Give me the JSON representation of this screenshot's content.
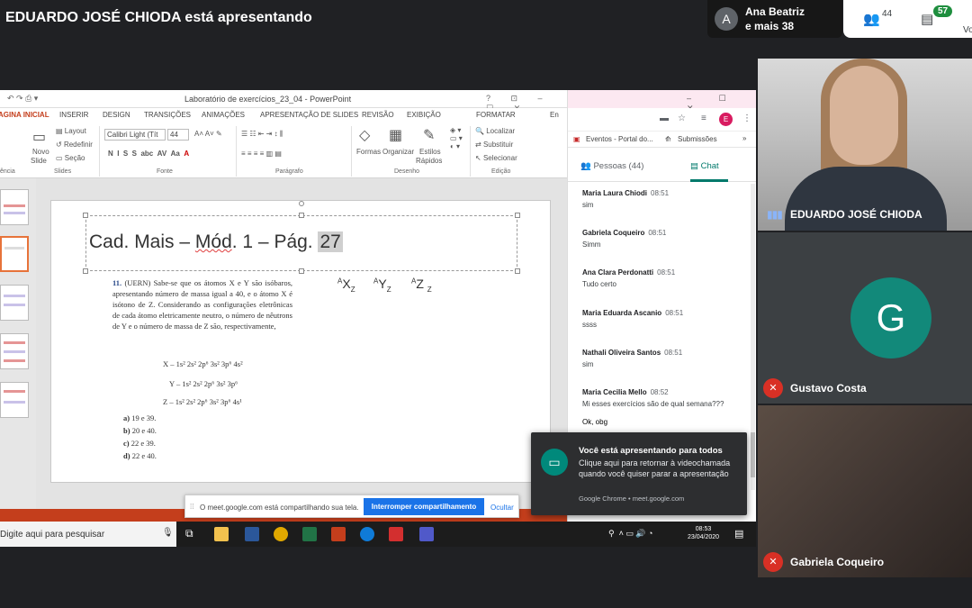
{
  "meet": {
    "presenter_banner": "EDUARDO JOSÉ CHIODA está apresentando",
    "top_user": {
      "avatar_letter": "A",
      "name": "Ana Beatriz",
      "others": "e mais 38"
    },
    "people_count": "44",
    "chat_badge": "57",
    "you_label": "Vo"
  },
  "powerpoint": {
    "window_title": "Laboratório de exercícios_23_04 - PowerPoint",
    "window_controls": "? ⊡ – ☐ ✕",
    "tabs": [
      "AGINA INICIAL",
      "INSERIR",
      "DESIGN",
      "TRANSIÇÕES",
      "ANIMAÇÕES",
      "APRESENTAÇÃO DE SLIDES",
      "REVISÃO",
      "EXIBIÇÃO",
      "FORMATAR",
      "En"
    ],
    "ribbon": {
      "layout": "Layout",
      "redefinir": "Redefinir",
      "secao": "Seção",
      "novo_slide": "Novo",
      "novo_slide2": "Slide",
      "font_name": "Calibri Light (Tít",
      "font_size": "44",
      "formas": "Formas",
      "organizar": "Organizar",
      "estilos": "Estilos",
      "estilos2": "Rápidos",
      "localizar": "Localizar",
      "substituir": "Substituir",
      "selecionar": "Selecionar",
      "groups": {
        "area": "ência",
        "slides": "Slides",
        "fonte": "Fonte",
        "paragrafo": "Parágrafo",
        "desenho": "Desenho",
        "edicao": "Edição"
      }
    },
    "slide": {
      "title_pre": "Cad. Mais – ",
      "title_mod": "Mód",
      "title_mid": ". 1 – Pág. ",
      "title_page": "27",
      "question_num": "11.",
      "question_text": "(UERN) Sabe-se que os átomos X e Y são isóbaros, apresentando número de massa igual a 40, e o átomo X é isótono de Z. Considerando as configurações eletrônicas de cada átomo eletricamente neutro, o número de nêutrons de Y e o número de massa de Z são, respectivamente,",
      "formula_x": "X – 1s² 2s² 2p⁶ 3s² 3p⁶ 4s²",
      "formula_y": "Y – 1s² 2s² 2p⁶ 3s² 3p⁶",
      "formula_z": "Z – 1s² 2s² 2p⁶ 3s² 3p⁶ 4s¹",
      "options": [
        {
          "letter": "a)",
          "text": "19 e 39."
        },
        {
          "letter": "b)",
          "text": "20 e 40."
        },
        {
          "letter": "c)",
          "text": "22 e 39."
        },
        {
          "letter": "d)",
          "text": "22 e 40."
        }
      ],
      "atoms": [
        {
          "sup": "A",
          "sym": "X",
          "sub": "Z"
        },
        {
          "sup": "A",
          "sym": "Y",
          "sub": "Z"
        },
        {
          "sup": "A",
          "sym": "Z",
          "sub": "Z"
        }
      ]
    }
  },
  "share_bar": {
    "message": "O meet.google.com está compartilhando sua tela.",
    "stop_label": "Interromper compartilhamento",
    "hide_label": "Ocultar"
  },
  "taskbar": {
    "search_placeholder": "Digite aqui para pesquisar",
    "time": "08:53",
    "date": "23/04/2020"
  },
  "chrome": {
    "bookmarks": [
      "Eventos - Portal do...",
      "Submissões"
    ],
    "people_tab": "Pessoas (44)",
    "chat_tab": "Chat",
    "profile_letter": "E",
    "messages": [
      {
        "who": "Maria Laura Chiodi",
        "time": "08:51",
        "text": "sim"
      },
      {
        "who": "Gabriela Coqueiro",
        "time": "08:51",
        "text": "Simm"
      },
      {
        "who": "Ana Clara Perdonatti",
        "time": "08:51",
        "text": "Tudo certo"
      },
      {
        "who": "Maria Eduarda Ascanio",
        "time": "08:51",
        "text": "ssss"
      },
      {
        "who": "Nathali Oliveira Santos",
        "time": "08:51",
        "text": "sim"
      },
      {
        "who": "Maria Cecilia Mello",
        "time": "08:52",
        "text": "Mi esses exercícios são de qual semana???"
      }
    ],
    "last_text": "Ok, obg"
  },
  "toast": {
    "heading": "Você está apresentando para todos",
    "body": "Clique aqui para retornar à videochamada quando você quiser parar a apresentação",
    "footer": "Google Chrome • meet.google.com"
  },
  "participants": [
    {
      "name": "EDUARDO JOSÉ CHIODA"
    },
    {
      "name": "Gustavo Costa",
      "avatar_letter": "G"
    },
    {
      "name": "Gabriela Coqueiro"
    }
  ]
}
